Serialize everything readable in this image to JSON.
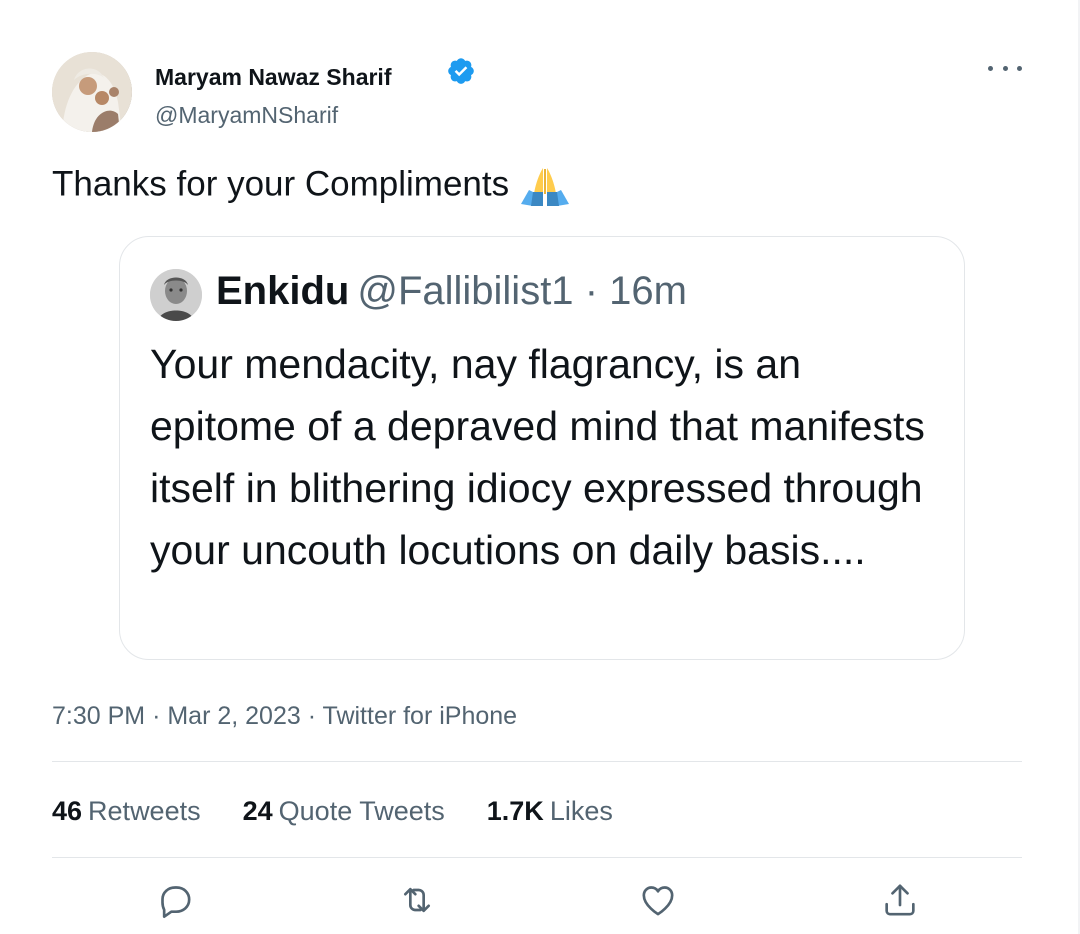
{
  "tweet": {
    "author_name": "Maryam Nawaz Sharif",
    "author_handle": "@MaryamNSharif",
    "text": "Thanks for your Compliments",
    "emoji": "folded-hands",
    "timestamp": "7:30 PM",
    "date": "Mar 2, 2023",
    "source": "Twitter for iPhone",
    "separator": "·"
  },
  "quoted": {
    "name": "Enkidu",
    "handle": "@Fallibilist1",
    "time": "16m",
    "separator": "·",
    "text": "Your mendacity, nay flagrancy, is an epitome of a depraved mind that manifests itself in blithering idiocy expressed through your uncouth locutions on daily basis...."
  },
  "stats": {
    "retweets_count": "46",
    "retweets_label": "Retweets",
    "quotes_count": "24",
    "quotes_label": "Quote Tweets",
    "likes_count": "1.7K",
    "likes_label": "Likes"
  },
  "icons": {
    "verified": "verified-badge-icon",
    "more": "more-options-icon",
    "reply": "reply-icon",
    "retweet": "retweet-icon",
    "like": "heart-icon",
    "share": "share-icon"
  },
  "colors": {
    "verified": "#1d9bf0",
    "text": "#0f1419",
    "secondary": "#536471",
    "border": "#e3e6e9"
  }
}
